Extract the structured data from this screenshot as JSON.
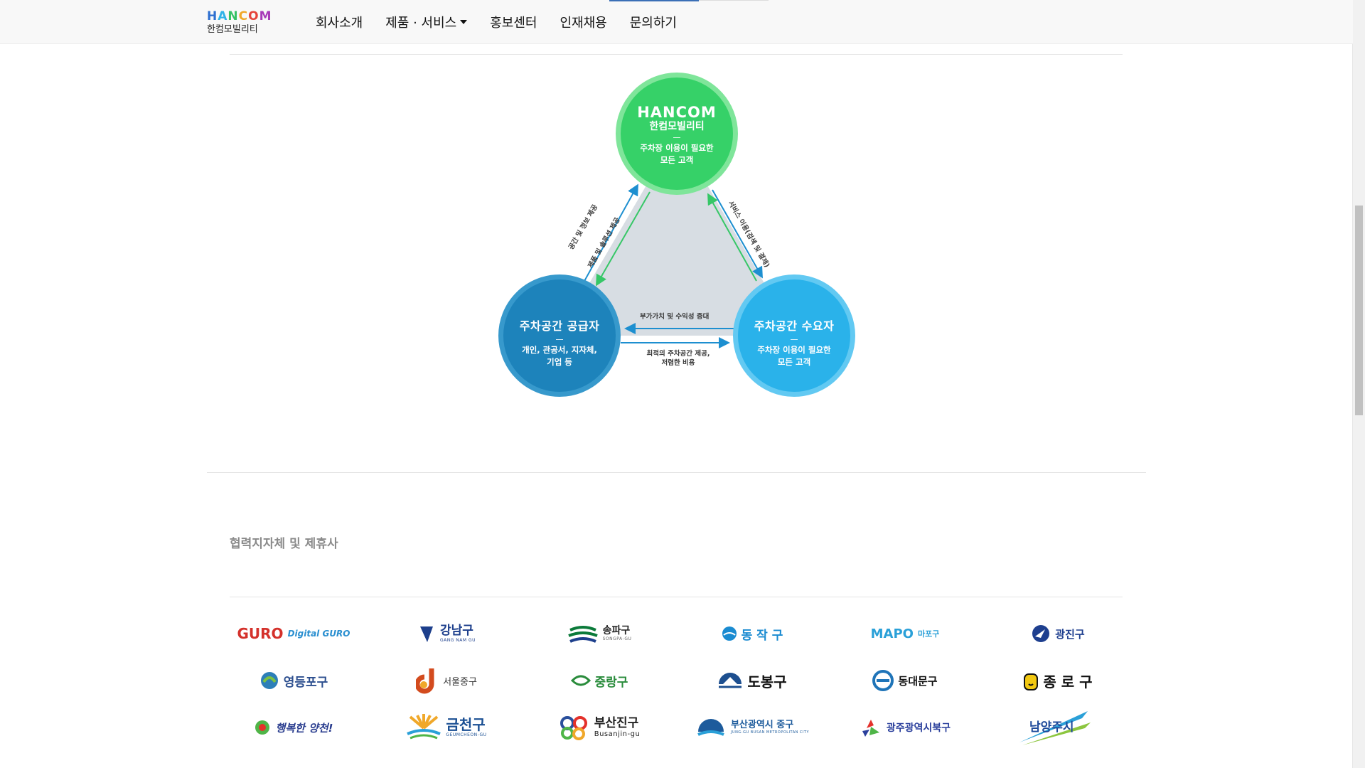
{
  "header": {
    "logo_word": "HANCOM",
    "logo_sub": "한컴모빌리티",
    "nav": [
      {
        "label": "회사소개"
      },
      {
        "label": "제품 · 서비스"
      },
      {
        "label": "홍보센터"
      },
      {
        "label": "인재채용"
      },
      {
        "label": "문의하기"
      }
    ]
  },
  "diagram": {
    "top_node": {
      "brand": "HANCOM",
      "brand_sub": "한컴모빌리티",
      "desc_line1": "주차장 이용이 필요한",
      "desc_line2": "모든 고객"
    },
    "left_node": {
      "title": "주차공간 공급자",
      "desc_line1": "개인, 관공서, 지자체,",
      "desc_line2": "기업 등"
    },
    "right_node": {
      "title": "주차공간 수요자",
      "desc_line1": "주차장 이용이 필요한",
      "desc_line2": "모든 고객"
    },
    "edges": {
      "left_up": "공간 및 정보 제공",
      "left_down": "제품 및 솔루션 제공",
      "right_side": "서비스 이용(검색 및 결제)",
      "bottom_top": "부가가치 및 수익성 증대",
      "bottom_line1": "최적의 주차공간 제공,",
      "bottom_line2": "저렴한 비용"
    },
    "colors": {
      "green": "#36d168",
      "dark_blue": "#1d83bb",
      "light_blue": "#2ab2ea",
      "triangle": "#d7dde3"
    }
  },
  "partners": {
    "title": "협력지자체 및 제휴사",
    "logos": [
      {
        "name": "Digital GURO",
        "prefix": "GURO",
        "icon": "guro-logo",
        "color": "#d4312b"
      },
      {
        "name": "강남구",
        "en": "GANG NAM GU",
        "icon": "gangnam-logo",
        "color": "#1d3f8c"
      },
      {
        "name": "송파구",
        "en": "SONGPA-GU",
        "icon": "songpa-logo",
        "color": "#0b7a3a"
      },
      {
        "name": "동 작 구",
        "icon": "dongjak-logo",
        "color": "#1a8bd1"
      },
      {
        "name": "마포구",
        "prefix": "MAPO",
        "icon": "mapo-logo",
        "color": "#2aa0d8"
      },
      {
        "name": "광진구",
        "icon": "gwangjin-logo",
        "color": "#1e3f8f"
      },
      {
        "name": "영등포구",
        "icon": "yeongdeungpo-logo",
        "color": "#2d7fb8"
      },
      {
        "name": "서울중구",
        "icon": "seoul-junggu-logo",
        "color": "#d34b1e"
      },
      {
        "name": "중랑구",
        "icon": "jungnang-logo",
        "color": "#2a8c3c"
      },
      {
        "name": "도봉구",
        "icon": "dobong-logo",
        "color": "#1d4f8f"
      },
      {
        "name": "동대문구",
        "icon": "dongdaemun-logo",
        "color": "#1f74b8"
      },
      {
        "name": "종 로 구",
        "icon": "jongno-logo",
        "color": "#111111"
      },
      {
        "name": "행복한 양천!",
        "icon": "yangcheon-logo",
        "color": "#2a3d8f"
      },
      {
        "name": "금천구",
        "en": "GEUMCHEON-GU",
        "icon": "geumcheon-logo",
        "color": "#1a4f93"
      },
      {
        "name": "부산진구",
        "en": "Busanjin-gu",
        "icon": "busanjin-logo",
        "color": "#222222"
      },
      {
        "name": "부산광역시 중구",
        "en": "JUNG-GU BUSAN METROPOLITAN CITY",
        "icon": "busan-junggu-logo",
        "color": "#1d5b9c"
      },
      {
        "name": "광주광역시북구",
        "icon": "gwangju-bukgu-logo",
        "color": "#2a3f9c"
      },
      {
        "name": "남양주시",
        "icon": "namyangju-logo",
        "color": "#1e4a9a"
      }
    ]
  }
}
